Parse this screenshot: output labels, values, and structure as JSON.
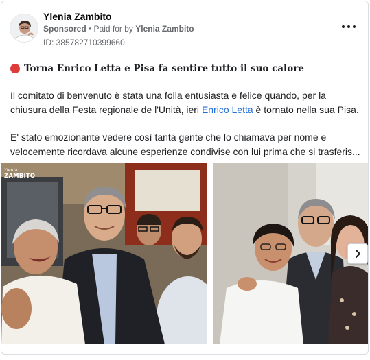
{
  "ad": {
    "page_name": "Ylenia Zambito",
    "sponsored_label": "Sponsored",
    "separator": " • ",
    "paid_prefix": "Paid for by ",
    "payer": "Ylenia Zambito",
    "id_line": "ID: 385782710399660",
    "headline": "Torna Enrico Letta e Pisa fa sentire tutto il suo calore",
    "para1_before": "Il comitato di benvenuto è stata una folla entusiasta e felice quando, per la chiusura della Festa regionale de l'Unità, ieri ",
    "para1_link": "Enrico Letta",
    "para1_after": " è tornato nella sua Pisa.",
    "para2": "E' stato emozionante vedere così tanta gente che lo chiamava per nome e velocemente ricordava alcune esperienze condivise con lui prima che si trasferis..."
  },
  "carousel": {
    "watermark_small": "Ylenia",
    "watermark_big": "ZAMBITO"
  },
  "icons": {
    "more": "more-horizontal-icon",
    "status_dot": "red-circle-icon",
    "next": "chevron-right-icon"
  },
  "colors": {
    "link": "#216fdb",
    "muted": "#65676b",
    "red_dot": "#e03b3b"
  }
}
